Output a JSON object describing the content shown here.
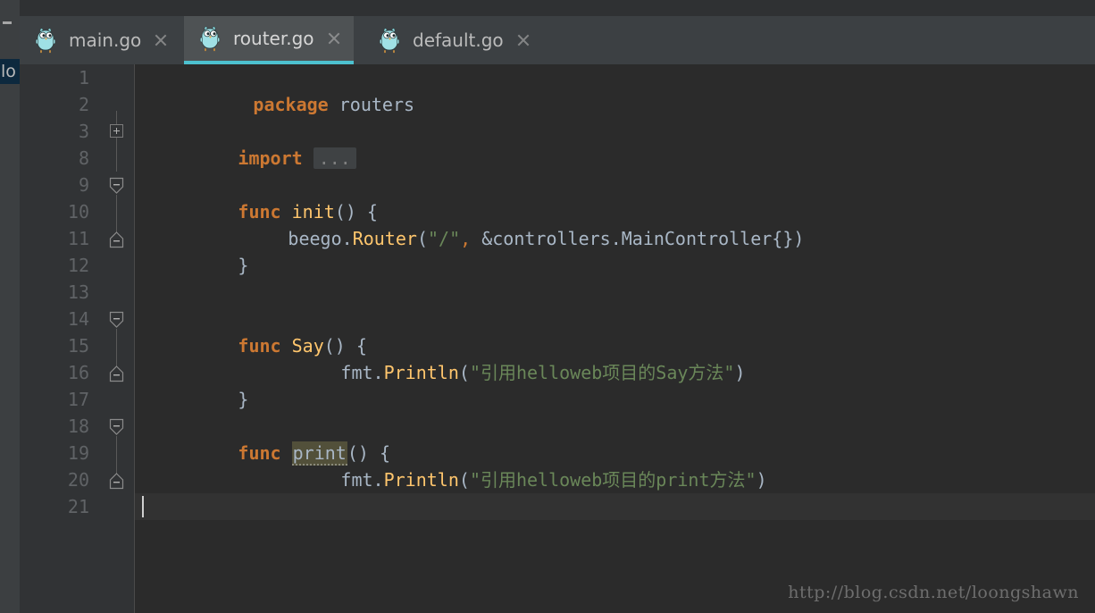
{
  "window": {
    "theme_background": "#2b2b2b",
    "accent_color": "#4dc1cf"
  },
  "left_panel": {
    "truncated_item_label": "lo",
    "collapse_icon": "minus-icon"
  },
  "tabs": [
    {
      "label": "main.go",
      "icon": "go-gopher-icon",
      "active": false,
      "close_icon": "close-icon"
    },
    {
      "label": "router.go",
      "icon": "go-gopher-icon",
      "active": true,
      "close_icon": "close-icon"
    },
    {
      "label": "default.go",
      "icon": "go-gopher-icon",
      "active": false,
      "close_icon": "close-icon"
    }
  ],
  "editor": {
    "language": "go",
    "caret_line": 21,
    "lines": [
      {
        "number": "1",
        "fold": "none"
      },
      {
        "number": "2",
        "fold": "none"
      },
      {
        "number": "3",
        "fold": "plus"
      },
      {
        "number": "8",
        "fold": "none"
      },
      {
        "number": "9",
        "fold": "start"
      },
      {
        "number": "10",
        "fold": "bar"
      },
      {
        "number": "11",
        "fold": "end"
      },
      {
        "number": "12",
        "fold": "none"
      },
      {
        "number": "13",
        "fold": "none"
      },
      {
        "number": "14",
        "fold": "start"
      },
      {
        "number": "15",
        "fold": "bar"
      },
      {
        "number": "16",
        "fold": "end"
      },
      {
        "number": "17",
        "fold": "none"
      },
      {
        "number": "18",
        "fold": "start"
      },
      {
        "number": "19",
        "fold": "bar"
      },
      {
        "number": "20",
        "fold": "end"
      },
      {
        "number": "21",
        "fold": "none"
      }
    ],
    "code": {
      "l1_package_kw": "package",
      "l1_package_name": "routers",
      "l3_import_kw": "import",
      "l3_folded_placeholder": "...",
      "l9_func_kw": "func",
      "l9_name": "init",
      "l9_tail": "() {",
      "l10_recv": "beego",
      "l10_dot": ".",
      "l10_call": "Router",
      "l10_open": "(",
      "l10_str": "\"/\"",
      "l10_comma": ",",
      "l10_arg": " &controllers.MainController{}",
      "l10_close": ")",
      "l11_brace": "}",
      "l14_func_kw": "func",
      "l14_name": "Say",
      "l14_tail": "() {",
      "l15_recv": "fmt",
      "l15_dot": ".",
      "l15_call": "Println",
      "l15_open": "(",
      "l15_str": "\"引用helloweb项目的Say方法\"",
      "l15_close": ")",
      "l16_brace": "}",
      "l18_func_kw": "func",
      "l18_name": "print",
      "l18_tail": "() {",
      "l19_recv": "fmt",
      "l19_dot": ".",
      "l19_call": "Println",
      "l19_open": "(",
      "l19_str": "\"引用helloweb项目的print方法\"",
      "l19_close": ")",
      "l20_brace": "}"
    }
  },
  "watermark": {
    "text": "http://blog.csdn.net/loongshawn"
  }
}
